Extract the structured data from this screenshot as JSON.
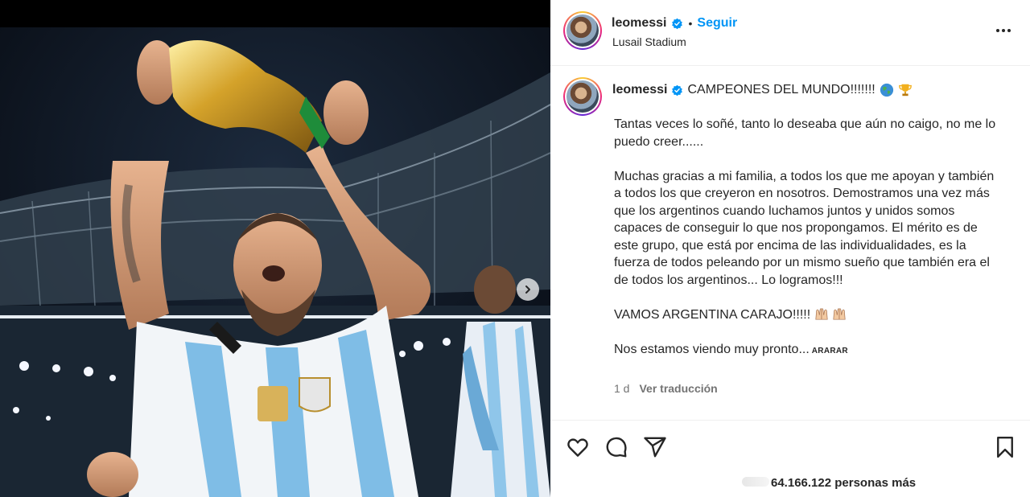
{
  "post": {
    "username": "leomessi",
    "follow_label": "Seguir",
    "location": "Lusail Stadium",
    "separator": "•"
  },
  "caption": {
    "username": "leomessi",
    "headline": "CAMPEONES DEL MUNDO!!!!!!!",
    "paragraphs": [
      "Tantas veces lo soñé, tanto lo deseaba que aún no caigo, no me lo puedo creer......",
      "Muchas gracias a mi familia, a todos los que me apoyan y también a todos los que creyeron en nosotros. Demostramos una vez más que los argentinos cuando luchamos juntos y unidos somos capaces de conseguir lo que nos propongamos. El mérito es de este grupo, que está por encima de las individualidades, es la fuerza de todos peleando por un mismo sueño que también era el de todos los argentinos... Lo logramos!!!",
      "VAMOS ARGENTINA CARAJO!!!!!"
    ],
    "last_line": "Nos estamos viendo muy pronto...",
    "last_line_tag": "ARARAR",
    "time": "1 d",
    "translate_label": "Ver traducción"
  },
  "likes": {
    "count_text": "64.166.122 personas más"
  },
  "icons": {
    "verified": "verified-badge-icon",
    "globe": "globe-emoji-icon",
    "trophy": "trophy-emoji-icon",
    "raised_hands": "raised-hands-emoji-icon",
    "like": "heart-icon",
    "comment": "comment-icon",
    "share": "share-icon",
    "save": "bookmark-icon",
    "more": "more-options-icon",
    "next": "chevron-right-icon"
  },
  "colors": {
    "accent": "#0095f6",
    "text": "#262626",
    "muted": "#737373",
    "verified": "#0095f6"
  }
}
